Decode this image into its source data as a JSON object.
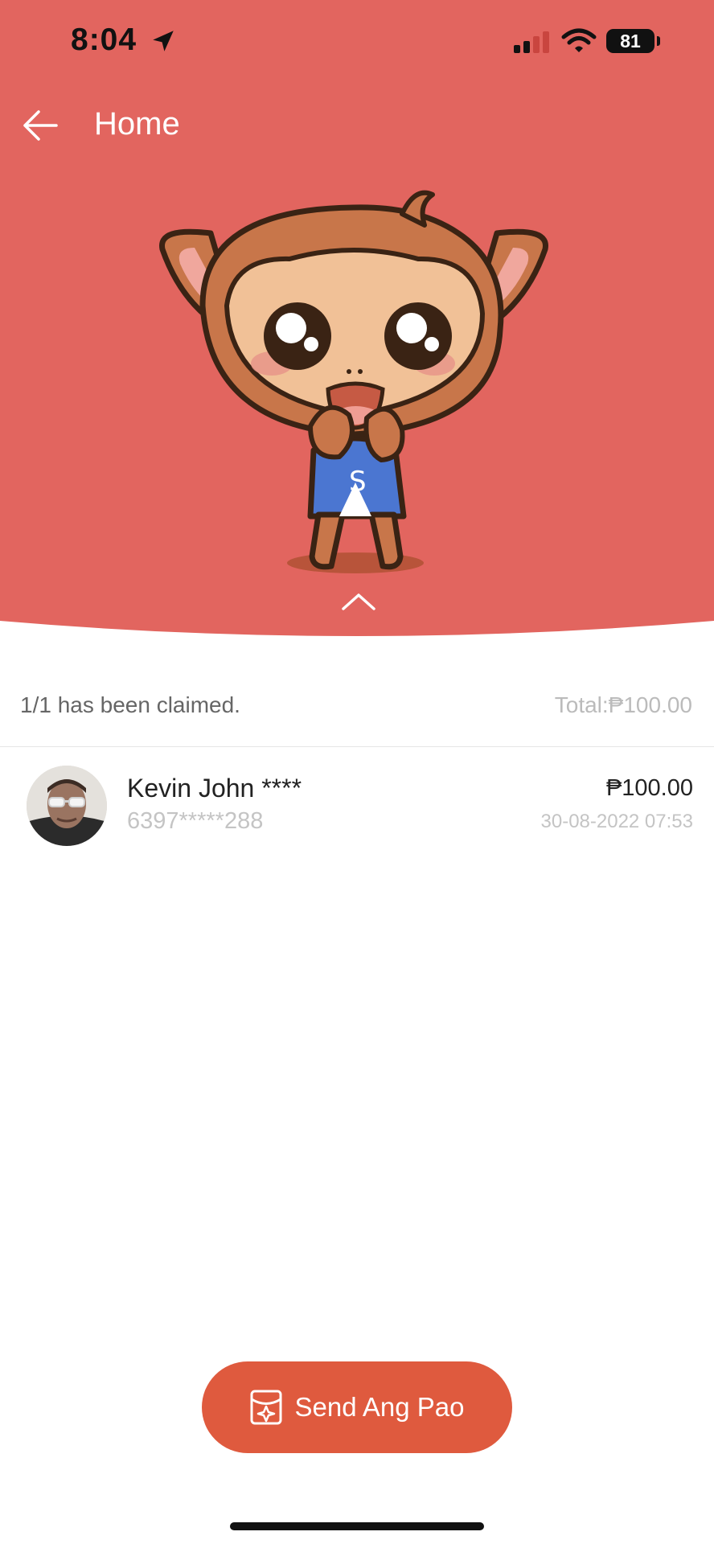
{
  "status_bar": {
    "time": "8:04",
    "battery": "81",
    "icons": [
      "location-arrow-icon",
      "cellular-signal-icon",
      "wifi-icon",
      "battery-icon"
    ]
  },
  "nav": {
    "back_icon": "arrow-left-icon",
    "title": "Home"
  },
  "header": {
    "background_color": "#e2655f",
    "illustration": "monkey-mascot",
    "collapse_icon": "chevron-up-icon"
  },
  "summary": {
    "claimed": "1/1 has been claimed.",
    "total": "Total:₱100.00"
  },
  "claims": [
    {
      "name": "Kevin John ****",
      "phone": "6397*****288",
      "amount": "₱100.00",
      "datetime": "30-08-2022 07:53"
    }
  ],
  "actions": {
    "send_label": "Send Ang Pao",
    "send_icon": "red-envelope-icon",
    "button_color": "#df5a3e"
  }
}
